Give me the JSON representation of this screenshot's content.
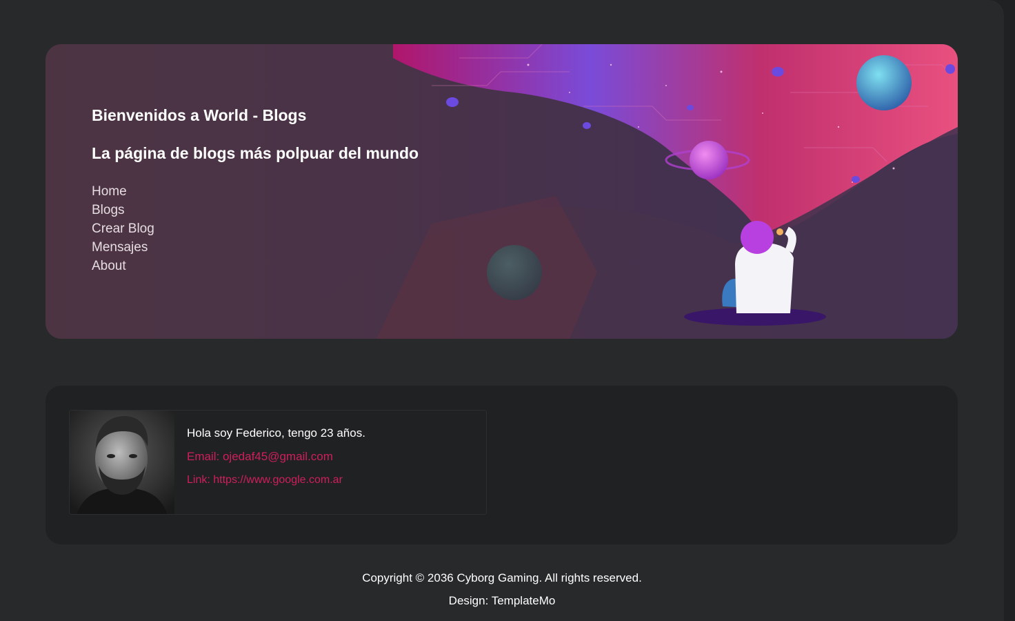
{
  "banner": {
    "welcome": "Bienvenidos a World - Blogs",
    "tagline": "La página de blogs más polpuar del mundo",
    "nav": [
      "Home",
      "Blogs",
      "Crear Blog",
      "Mensajes",
      "About"
    ]
  },
  "profile": {
    "intro": "Hola soy Federico, tengo 23 años.",
    "email_label": "Email:",
    "email": "ojedaf45@gmail.com",
    "link_label": "Link:",
    "link": "https://www.google.com.ar"
  },
  "footer": {
    "copyright": "Copyright © 2036 Cyborg Gaming. All rights reserved.",
    "design": "Design: TemplateMo"
  },
  "colors": {
    "page_bg": "#27292a",
    "panel_bg": "#1f2122",
    "accent": "#d01f5a"
  }
}
